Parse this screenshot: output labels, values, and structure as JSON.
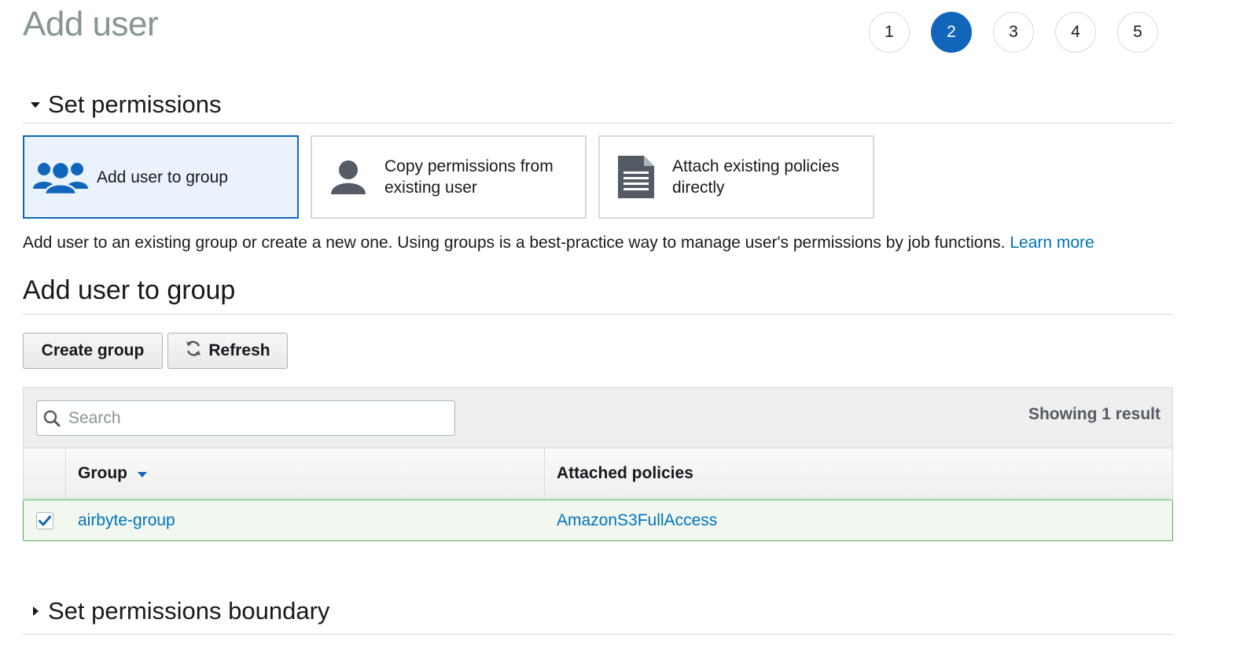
{
  "page": {
    "title": "Add user"
  },
  "steps": [
    "1",
    "2",
    "3",
    "4",
    "5"
  ],
  "active_step": "2",
  "set_permissions": {
    "title": "Set permissions",
    "options": [
      {
        "label": "Add user to group",
        "icon": "users-group-icon",
        "selected": true
      },
      {
        "label_line1": "Copy permissions from",
        "label_line2": "existing user",
        "icon": "user-icon",
        "selected": false
      },
      {
        "label_line1": "Attach existing policies",
        "label_line2": "directly",
        "icon": "document-icon",
        "selected": false
      }
    ],
    "description": "Add user to an existing group or create a new one. Using groups is a best-practice way to manage user's permissions by job functions.",
    "learn_more": "Learn more"
  },
  "add_user_to_group": {
    "title": "Add user to group",
    "create_group_label": "Create group",
    "refresh_label": "Refresh",
    "search_placeholder": "Search",
    "result_count": "Showing 1 result",
    "columns": {
      "group": "Group",
      "attached_policies": "Attached policies"
    },
    "rows": [
      {
        "group": "airbyte-group",
        "attached_policies": "AmazonS3FullAccess",
        "checked": true
      }
    ]
  },
  "permissions_boundary": {
    "title": "Set permissions boundary"
  },
  "colors": {
    "primary": "#1166bb",
    "link": "#0073bb",
    "selected_row_border": "#4caf50",
    "title_gray": "#879596"
  }
}
